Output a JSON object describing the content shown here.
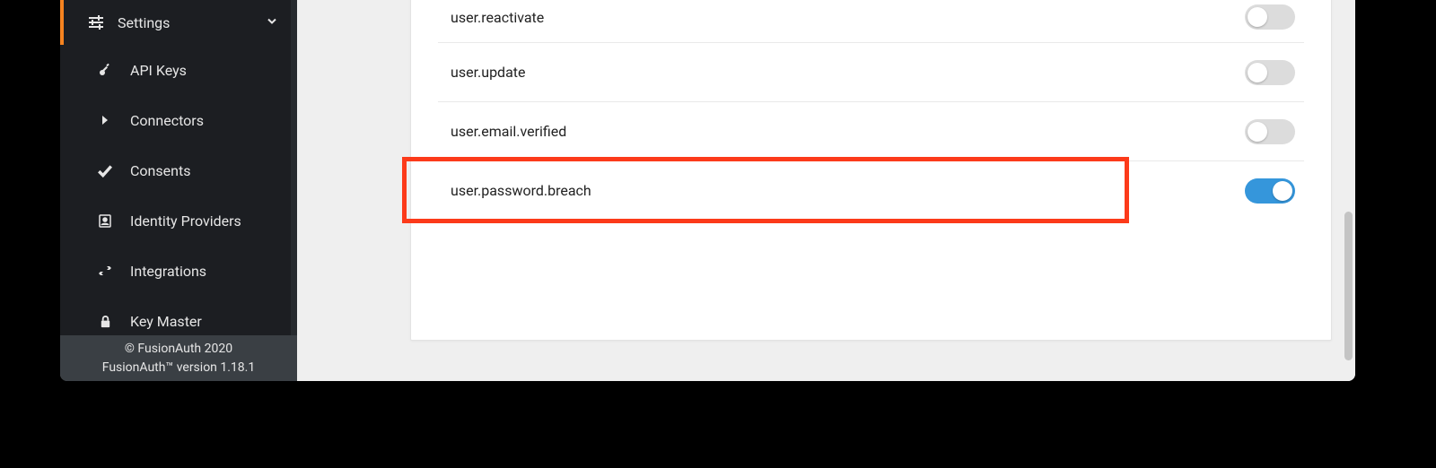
{
  "sidebar": {
    "header": {
      "label": "Settings"
    },
    "items": [
      {
        "label": "API Keys"
      },
      {
        "label": "Connectors"
      },
      {
        "label": "Consents"
      },
      {
        "label": "Identity Providers"
      },
      {
        "label": "Integrations"
      },
      {
        "label": "Key Master"
      }
    ],
    "footer": {
      "line1": "© FusionAuth 2020",
      "line2": "FusionAuth™ version 1.18.1"
    }
  },
  "events": {
    "rows": [
      {
        "label": "user.reactivate",
        "enabled": false
      },
      {
        "label": "user.update",
        "enabled": false
      },
      {
        "label": "user.email.verified",
        "enabled": false
      },
      {
        "label": "user.password.breach",
        "enabled": true
      }
    ]
  },
  "highlightRowIndex": 3
}
